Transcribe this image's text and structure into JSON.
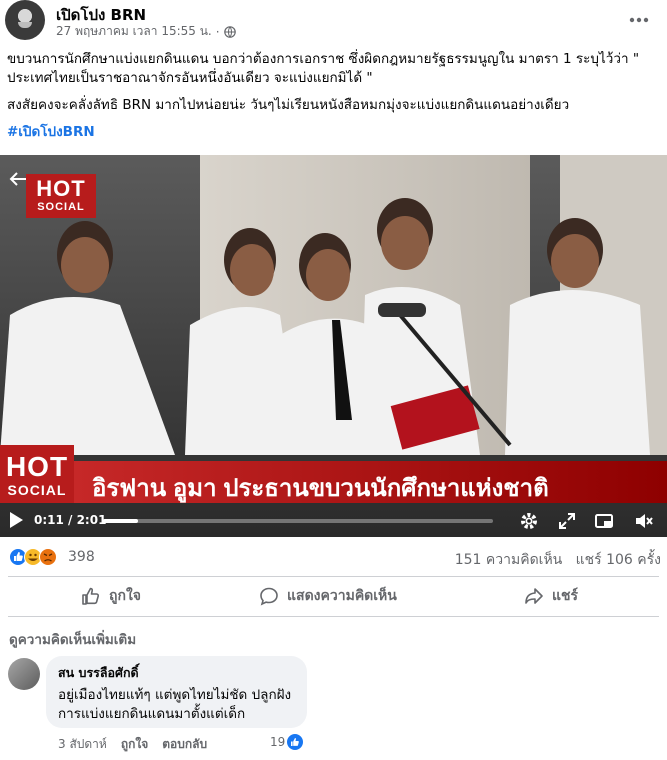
{
  "post": {
    "page_name": "เปิดโปง BRN",
    "date": "27 พฤษภาคม เวลา 15:55 น.",
    "separator": "·",
    "text_paragraph_1": "ขบวนการนักศึกษาแบ่งแยกดินแดน บอกว่าต้องการเอกราช ซึ่งผิดกฎหมายรัฐธรรมนูญใน มาตรา 1 ระบุไว้ว่า \" ประเทศไทยเป็นราชอาณาจักรอันหนึ่งอันเดียว จะแบ่งแยกมิได้ \"",
    "text_paragraph_2": "สงสัยคงจะคลั่งลัทธิ BRN มากไปหน่อยน่ะ วันๆไม่เรียนหนังสือหมกมุ่งจะแบ่งแยกดินแดนอย่างเดียว",
    "hashtag": "#เปิดโปงBRN"
  },
  "video": {
    "logo_hot": "HOT",
    "logo_social": "SOCIAL",
    "caption": "อิรฟาน อูมา ประธานขบวนนักศึกษาแห่งชาติ",
    "time": "0:11 / 2:01",
    "progress": 0.09
  },
  "engagement": {
    "reaction_count": "398",
    "comment_count": "151 ความคิดเห็น",
    "share_count": "แชร์ 106 ครั้ง"
  },
  "actions": {
    "like_label": "ถูกใจ",
    "comment_label": "แสดงความคิดเห็น",
    "share_label": "แชร์"
  },
  "comments_section": {
    "more_label": "ดูความคิดเห็นเพิ่มเติม",
    "comment": {
      "author": "สน บรรลือศักดิ์",
      "text": "อยู่เมืองไทยแท้ๆ แต่พูดไทยไม่ชัด ปลูกฝังการแบ่งแยกดินแดนมาตั้งแต่เด็ก",
      "age": "3 สัปดาห์",
      "like_label": "ถูกใจ",
      "reply_label": "ตอบกลับ",
      "likes": "19"
    }
  },
  "colors": {
    "accent_blue": "#1b74e4",
    "muted_text": "#65676b",
    "logo_red": "#b71c1c"
  }
}
